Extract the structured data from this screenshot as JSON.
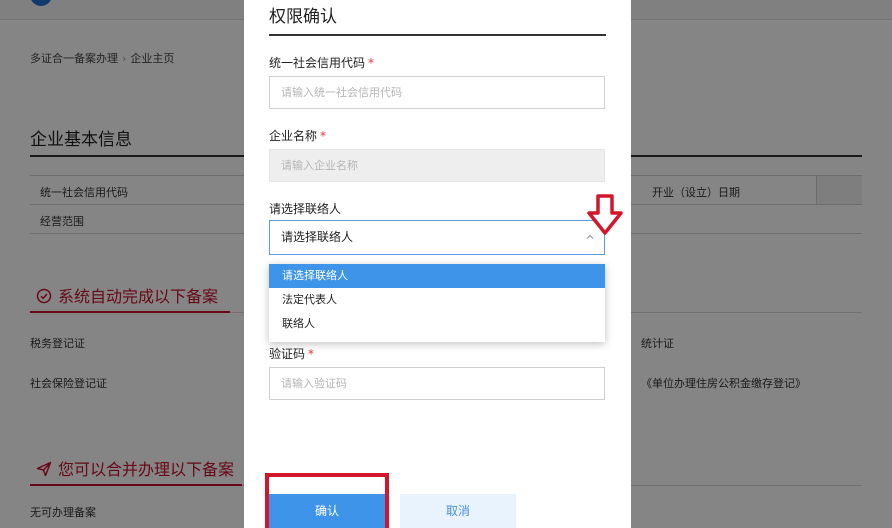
{
  "background": {
    "breadcrumb": [
      "多证合一备案办理",
      "企业主页"
    ],
    "breadcrumb_sep": "›",
    "section_title": "企业基本信息",
    "table": {
      "row1_left": "统一社会信用代码",
      "row1_right": "开业（设立）日期",
      "row2_left": "经营范围"
    },
    "auto_section_title": "系统自动完成以下备案",
    "auto_items_left": [
      "税务登记证",
      "社会保险登记证"
    ],
    "auto_items_right": [
      "统计证",
      "《单位办理住房公积金缴存登记》"
    ],
    "merge_section_title": "您可以合并办理以下备案",
    "merge_items_left": [
      "无可办理备案"
    ]
  },
  "modal": {
    "title": "权限确认",
    "required_mark": "*",
    "credit_code": {
      "label": "统一社会信用代码",
      "placeholder": "请输入统一社会信用代码"
    },
    "company_name": {
      "label": "企业名称",
      "placeholder": "请输入企业名称"
    },
    "contact": {
      "label": "请选择联络人",
      "value": "请选择联络人",
      "options": [
        "请选择联络人",
        "法定代表人",
        "联络人"
      ],
      "selected_index": 0
    },
    "captcha": {
      "label": "验证码",
      "placeholder": "请输入验证码"
    },
    "confirm_label": "确认",
    "cancel_label": "取消"
  },
  "colors": {
    "accent_blue": "#3e94e8",
    "required_red": "#e8343a",
    "annotation_red": "#d4162c",
    "section_red": "#c8102e"
  },
  "icons": {
    "auto_section": "check-circle-icon",
    "merge_section": "send-icon",
    "select_caret": "chevron-up-icon",
    "annotation": "arrow-down-icon"
  }
}
